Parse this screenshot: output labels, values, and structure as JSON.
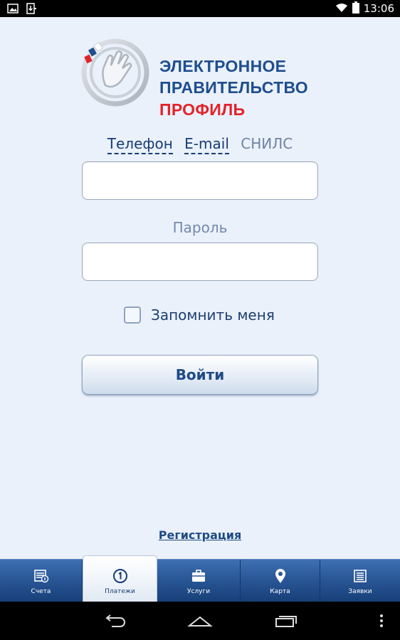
{
  "status_bar": {
    "time": "13:06",
    "icons": [
      "image-icon",
      "download-icon",
      "wifi-icon",
      "battery-icon"
    ]
  },
  "logo": {
    "line1": "ЭЛЕКТРОННОЕ",
    "line2": "ПРАВИТЕЛЬСТВО",
    "line3": "ПРОФИЛЬ",
    "colors": {
      "primary": "#1f4e8e",
      "accent": "#e3222b"
    }
  },
  "login_types": [
    {
      "label": "Телефон",
      "selected": false
    },
    {
      "label": "E-mail",
      "selected": false
    },
    {
      "label": "СНИЛС",
      "selected": true
    }
  ],
  "login_field": {
    "value": "",
    "placeholder": ""
  },
  "password_label": "Пароль",
  "password_field": {
    "value": "",
    "placeholder": ""
  },
  "remember": {
    "label": "Запомнить меня",
    "checked": false
  },
  "login_button": "Войти",
  "register_link": "Регистрация",
  "tabs": [
    {
      "label": "Счета",
      "icon": "accounts-icon",
      "active": false
    },
    {
      "label": "Платежи",
      "icon": "payments-icon",
      "active": true
    },
    {
      "label": "Услуги",
      "icon": "briefcase-icon",
      "active": false
    },
    {
      "label": "Карта",
      "icon": "map-pin-icon",
      "active": false
    },
    {
      "label": "Заявки",
      "icon": "list-icon",
      "active": false
    }
  ],
  "nav": [
    "back-icon",
    "home-icon",
    "recent-apps-icon",
    "more-icon"
  ],
  "colors": {
    "background": "#eaf1fa",
    "tab_bar": "#2a5797",
    "link": "#173c76"
  }
}
